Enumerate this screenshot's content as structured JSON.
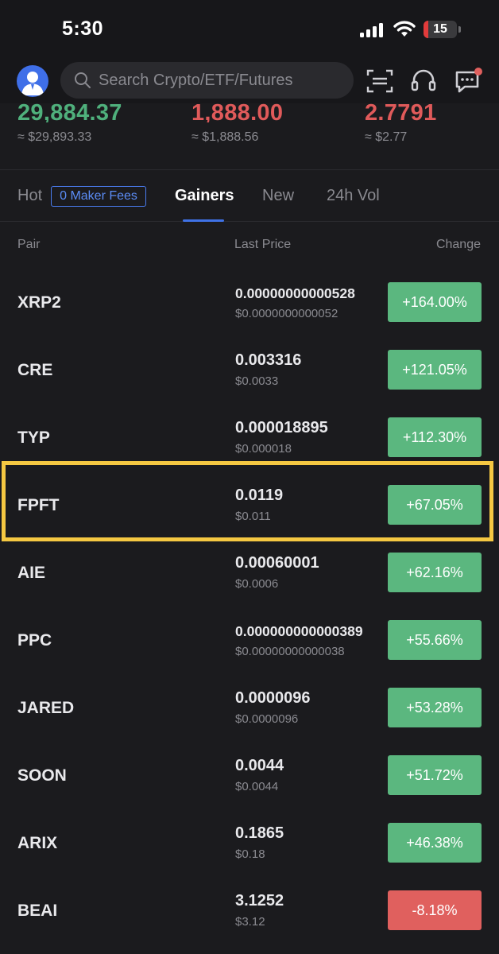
{
  "status_bar": {
    "time": "5:30",
    "battery": "15",
    "battery_level": 0.15
  },
  "header": {
    "search_placeholder": "Search Crypto/ETF/Futures"
  },
  "tickers": [
    {
      "price": "29,884.37",
      "usd": "≈ $29,893.33",
      "direction": "up"
    },
    {
      "price": "1,888.00",
      "usd": "≈ $1,888.56",
      "direction": "down"
    },
    {
      "price": "2.7791",
      "usd": "≈ $2.77",
      "direction": "down"
    }
  ],
  "tabs": {
    "hot": "Hot",
    "maker_fees": "0 Maker Fees",
    "gainers": "Gainers",
    "new": "New",
    "vol": "24h Vol"
  },
  "columns": {
    "pair": "Pair",
    "last_price": "Last Price",
    "change": "Change"
  },
  "rows": [
    {
      "pair": "XRP2",
      "price": "0.00000000000528",
      "usd": "$0.0000000000052",
      "change": "+164.00%",
      "direction": "up"
    },
    {
      "pair": "CRE",
      "price": "0.003316",
      "usd": "$0.0033",
      "change": "+121.05%",
      "direction": "up"
    },
    {
      "pair": "TYP",
      "price": "0.000018895",
      "usd": "$0.000018",
      "change": "+112.30%",
      "direction": "up"
    },
    {
      "pair": "FPFT",
      "price": "0.0119",
      "usd": "$0.011",
      "change": "+67.05%",
      "direction": "up"
    },
    {
      "pair": "AIE",
      "price": "0.00060001",
      "usd": "$0.0006",
      "change": "+62.16%",
      "direction": "up"
    },
    {
      "pair": "PPC",
      "price": "0.000000000000389",
      "usd": "$0.00000000000038",
      "change": "+55.66%",
      "direction": "up"
    },
    {
      "pair": "JARED",
      "price": "0.0000096",
      "usd": "$0.0000096",
      "change": "+53.28%",
      "direction": "up"
    },
    {
      "pair": "SOON",
      "price": "0.0044",
      "usd": "$0.0044",
      "change": "+51.72%",
      "direction": "up"
    },
    {
      "pair": "ARIX",
      "price": "0.1865",
      "usd": "$0.18",
      "change": "+46.38%",
      "direction": "up"
    },
    {
      "pair": "BEAI",
      "price": "3.1252",
      "usd": "$3.12",
      "change": "-8.18%",
      "direction": "down"
    }
  ],
  "colors": {
    "up": "#5bb77f",
    "down": "#e0605e",
    "accent": "#3f72e6",
    "highlight": "#f5c842"
  }
}
